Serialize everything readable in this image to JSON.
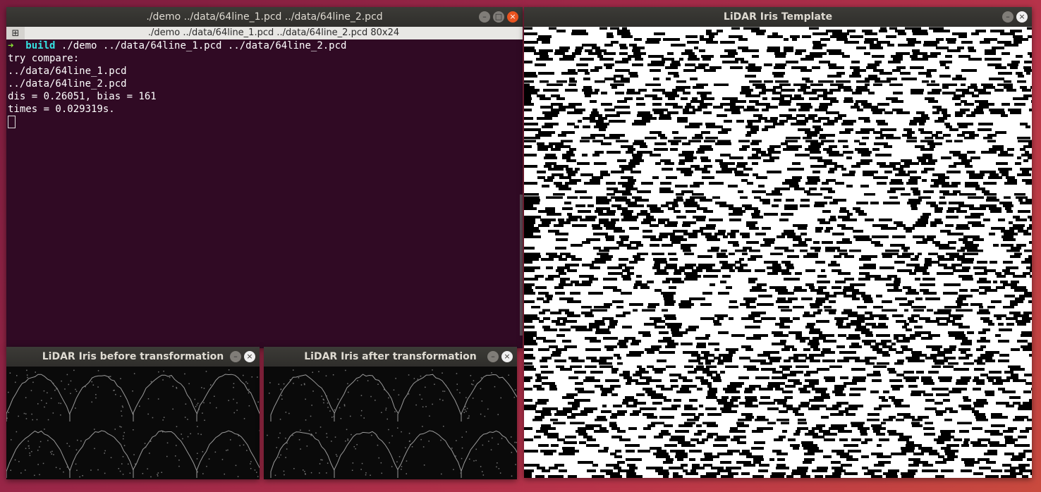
{
  "terminal": {
    "window_title": "./demo ../data/64line_1.pcd ../data/64line_2.pcd",
    "tab_title": "./demo ../data/64line_1.pcd ../data/64line_2.pcd 80x24",
    "prompt_arrow": "➜",
    "prompt_dir": "build",
    "command": "./demo ../data/64line_1.pcd ../data/64line_2.pcd",
    "output": [
      "try compare:",
      "../data/64line_1.pcd",
      "../data/64line_2.pcd",
      "dis = 0.26051, bias = 161",
      "times = 0.029319s."
    ]
  },
  "template_window": {
    "title": "LiDAR Iris Template"
  },
  "before_window": {
    "title": "LiDAR Iris before transformation"
  },
  "after_window": {
    "title": "LiDAR Iris after transformation"
  },
  "icons": {
    "minimize": "minimize-icon",
    "maximize": "maximize-icon",
    "close": "close-icon",
    "terminal_tab": "terminal-tab-icon"
  },
  "colors": {
    "terminal_bg": "#300a24",
    "prompt_arrow": "#8ae234",
    "prompt_dir": "#34e2e2",
    "close_active": "#e95420"
  }
}
